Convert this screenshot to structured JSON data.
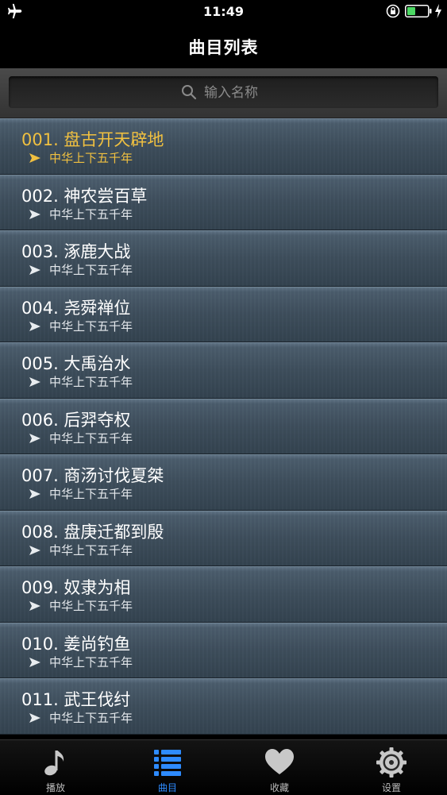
{
  "status": {
    "time": "11:49"
  },
  "nav": {
    "title": "曲目列表"
  },
  "search": {
    "placeholder": "输入名称"
  },
  "tracks": [
    {
      "name": "001. 盘古开天辟地",
      "album": "中华上下五千年",
      "active": true
    },
    {
      "name": "002. 神农尝百草",
      "album": "中华上下五千年"
    },
    {
      "name": "003. 涿鹿大战",
      "album": "中华上下五千年"
    },
    {
      "name": "004. 尧舜禅位",
      "album": "中华上下五千年"
    },
    {
      "name": "005. 大禹治水",
      "album": "中华上下五千年"
    },
    {
      "name": "006. 后羿夺权",
      "album": "中华上下五千年"
    },
    {
      "name": "007. 商汤讨伐夏桀",
      "album": "中华上下五千年"
    },
    {
      "name": "008. 盘庚迁都到殷",
      "album": "中华上下五千年"
    },
    {
      "name": "009. 奴隶为相",
      "album": "中华上下五千年"
    },
    {
      "name": "010. 姜尚钓鱼",
      "album": "中华上下五千年"
    },
    {
      "name": "011. 武王伐纣",
      "album": "中华上下五千年"
    }
  ],
  "tabs": [
    {
      "label": "播放",
      "icon": "music-note-icon"
    },
    {
      "label": "曲目",
      "icon": "list-icon",
      "active": true
    },
    {
      "label": "收藏",
      "icon": "heart-icon"
    },
    {
      "label": "设置",
      "icon": "gear-icon"
    }
  ],
  "colors": {
    "active_track": "#f0c040",
    "active_tab": "#2e8bff"
  }
}
